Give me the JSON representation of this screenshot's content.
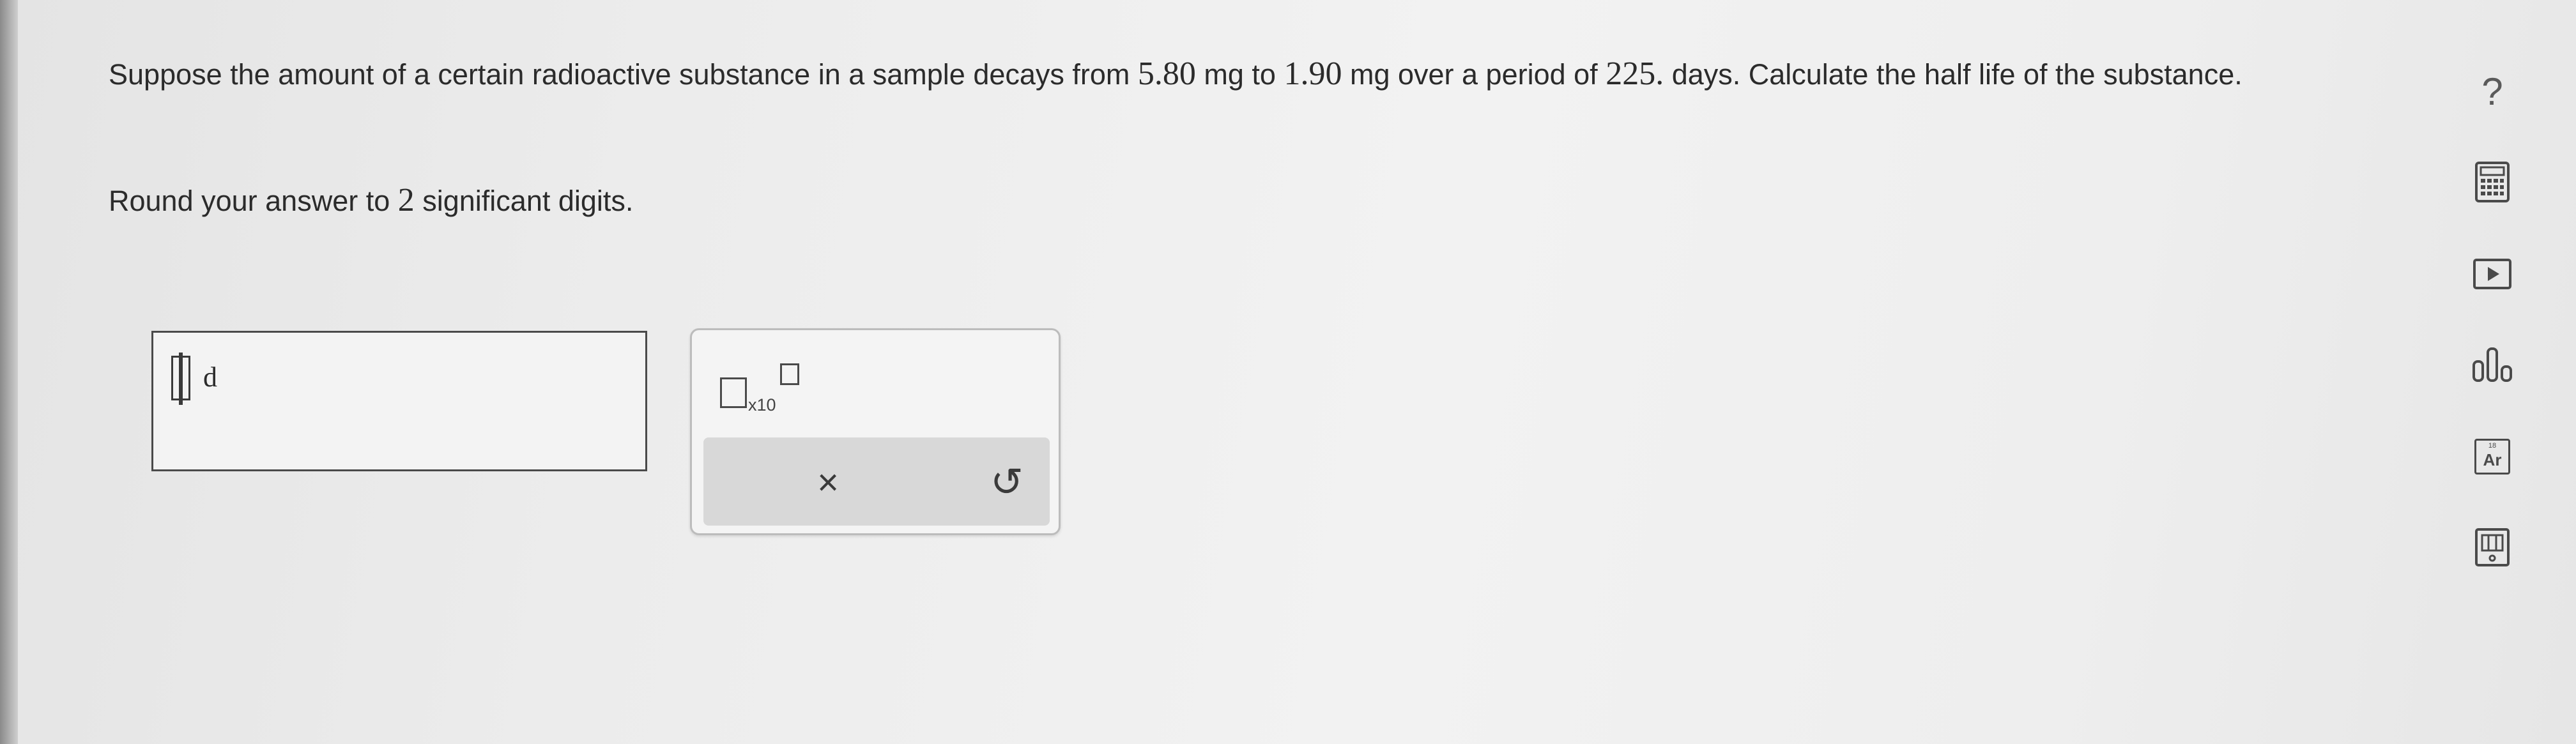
{
  "question": {
    "part1": "Suppose the amount of a certain radioactive substance in a sample decays from ",
    "initial_value": "5.80",
    "unit1": " mg to ",
    "final_value": "1.90",
    "unit2": " mg over a period of ",
    "period_value": "225.",
    "part2": " days. Calculate the half life of the substance."
  },
  "instruction": {
    "prefix": "Round your answer to ",
    "digits": "2",
    "suffix": " significant digits."
  },
  "answer": {
    "value": "",
    "unit": "d"
  },
  "keypad": {
    "sci_label": "x10",
    "clear_glyph": "×",
    "undo_glyph": "↺"
  },
  "toolbar": {
    "help_glyph": "?",
    "periodic_number": "18",
    "periodic_symbol": "Ar"
  },
  "icons": [
    "help-icon",
    "calculator-icon",
    "video-icon",
    "chart-icon",
    "periodic-table-icon",
    "textbook-icon"
  ]
}
